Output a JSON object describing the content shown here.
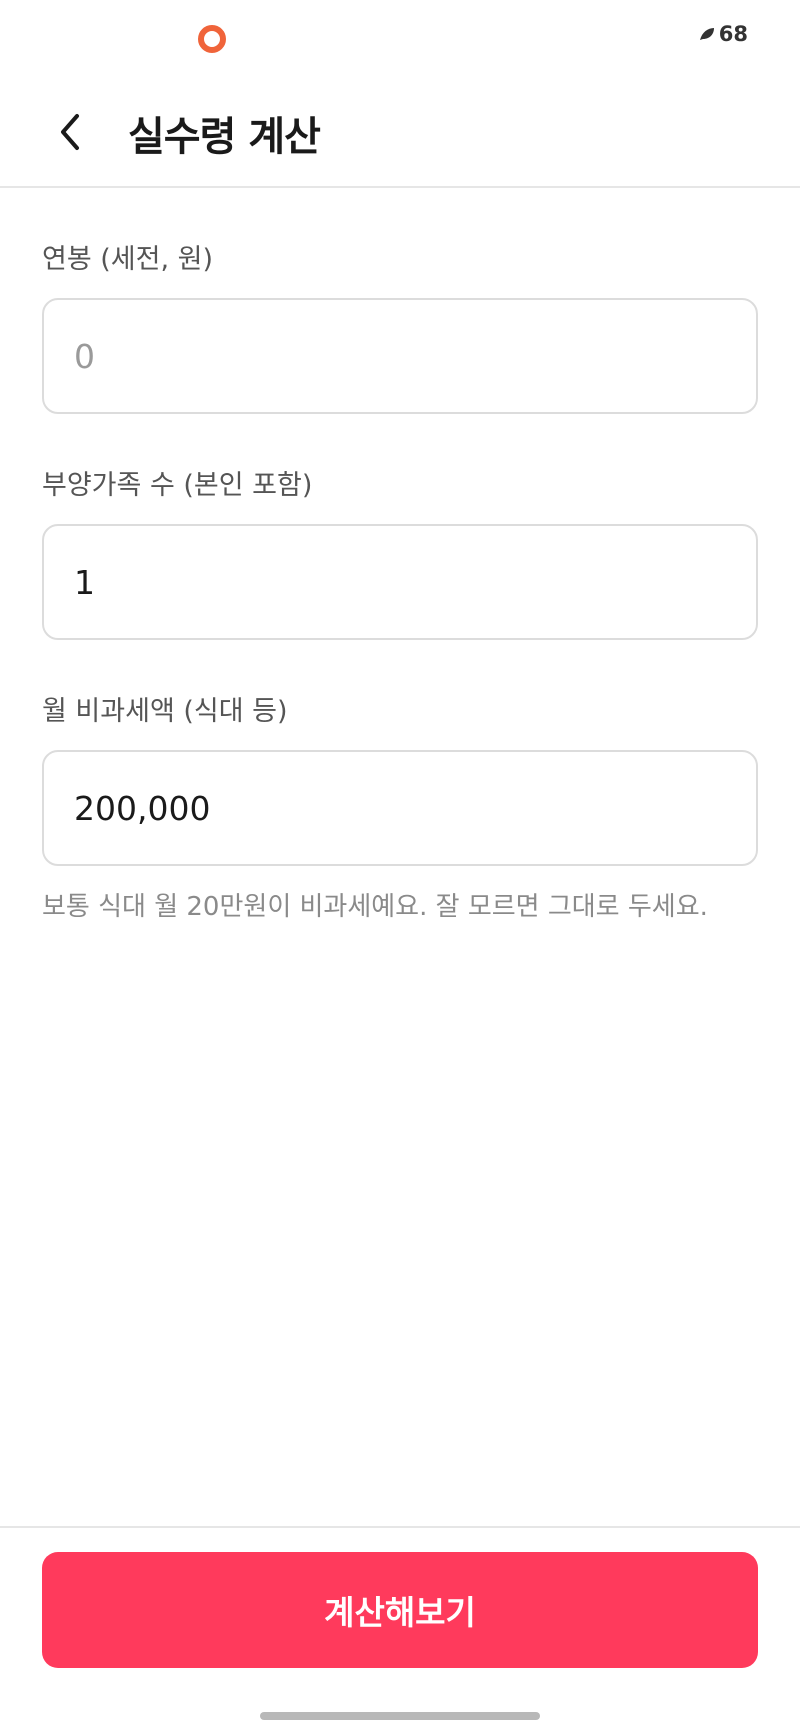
{
  "status_bar": {
    "battery_text": "68",
    "indicator_color": "#f0643a",
    "leaf_icon": "leaf-icon"
  },
  "header": {
    "back_icon": "chevron-left-icon",
    "title": "실수령 계산"
  },
  "form": {
    "annual_salary": {
      "label": "연봉 (세전, 원)",
      "value": "",
      "placeholder": "0"
    },
    "dependents": {
      "label": "부양가족 수 (본인 포함)",
      "value": "1",
      "placeholder": ""
    },
    "non_taxable": {
      "label": "월 비과세액 (식대 등)",
      "value": "200,000",
      "placeholder": "",
      "hint": "보통 식대 월 20만원이 비과세예요. 잘 모르면 그대로 두세요."
    }
  },
  "actions": {
    "calculate_label": "계산해보기",
    "button_color": "#ff3a5c"
  }
}
